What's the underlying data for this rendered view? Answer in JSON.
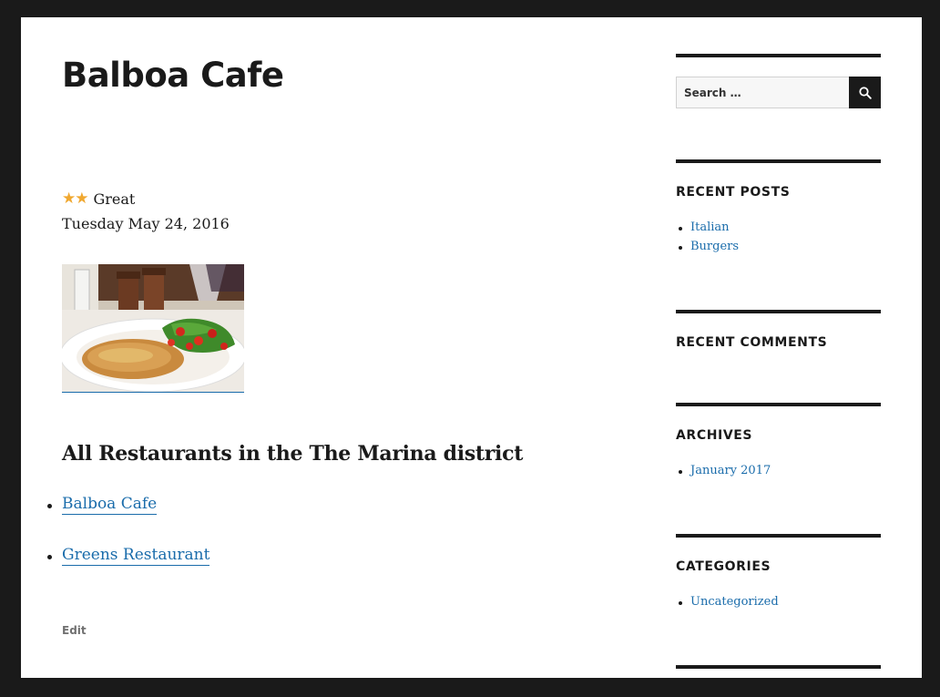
{
  "site": {
    "title": "Balboa Cafe"
  },
  "post": {
    "rating_stars": "★★",
    "rating_label": "Great",
    "date": "Tuesday May 24, 2016",
    "image_icon": "food-photo",
    "section_heading": "All Restaurants in the The Marina district",
    "restaurants": [
      "Balboa Cafe",
      "Greens Restaurant"
    ],
    "edit_label": "Edit"
  },
  "sidebar": {
    "search": {
      "placeholder": "Search …",
      "button_icon": "search-icon"
    },
    "recent_posts": {
      "title": "RECENT POSTS",
      "items": [
        "Italian",
        "Burgers"
      ]
    },
    "recent_comments": {
      "title": "RECENT COMMENTS"
    },
    "archives": {
      "title": "ARCHIVES",
      "items": [
        "January 2017"
      ]
    },
    "categories": {
      "title": "CATEGORIES",
      "items": [
        "Uncategorized"
      ]
    }
  },
  "colors": {
    "frame": "#1a1a1a",
    "link": "#1a6cab",
    "star": "#f0a830"
  }
}
